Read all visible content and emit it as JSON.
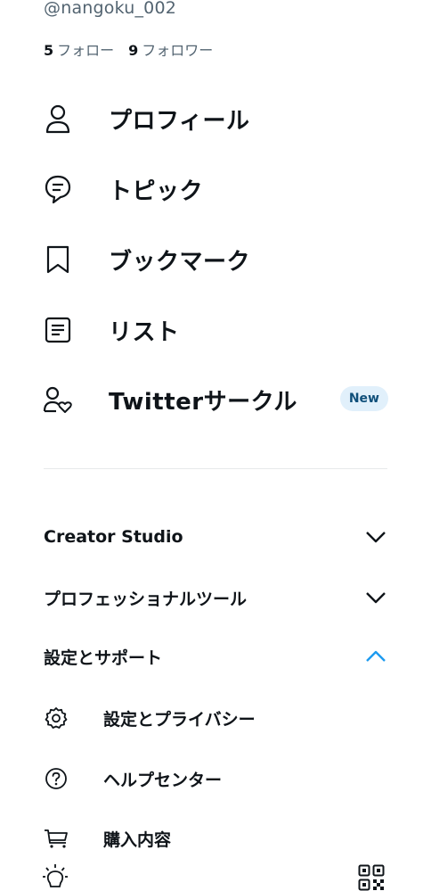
{
  "profile": {
    "handle": "@nangoku_002",
    "following_count": "5",
    "following_label": "フォロー",
    "followers_count": "9",
    "followers_label": "フォロワー"
  },
  "menu": {
    "items": [
      {
        "label": "プロフィール",
        "icon": "person-icon"
      },
      {
        "label": "トピック",
        "icon": "topic-bubble-icon"
      },
      {
        "label": "ブックマーク",
        "icon": "bookmark-icon"
      },
      {
        "label": "リスト",
        "icon": "list-icon"
      },
      {
        "label": "Twitterサークル",
        "icon": "circle-person-heart-icon",
        "badge": "New"
      }
    ]
  },
  "sections": {
    "creator_studio": "Creator Studio",
    "pro_tools": "プロフェッショナルツール",
    "settings_support": "設定とサポート"
  },
  "settings_items": [
    {
      "label": "設定とプライバシー",
      "icon": "gear-icon"
    },
    {
      "label": "ヘルプセンター",
      "icon": "help-circle-icon"
    },
    {
      "label": "購入内容",
      "icon": "cart-icon"
    }
  ],
  "footer": {
    "left_icon": "brightness-icon",
    "right_icon": "qr-code-icon"
  },
  "colors": {
    "text": "#0f1419",
    "secondary": "#536471",
    "accent": "#1d9bf0",
    "badge_bg": "#e1f0fb"
  }
}
